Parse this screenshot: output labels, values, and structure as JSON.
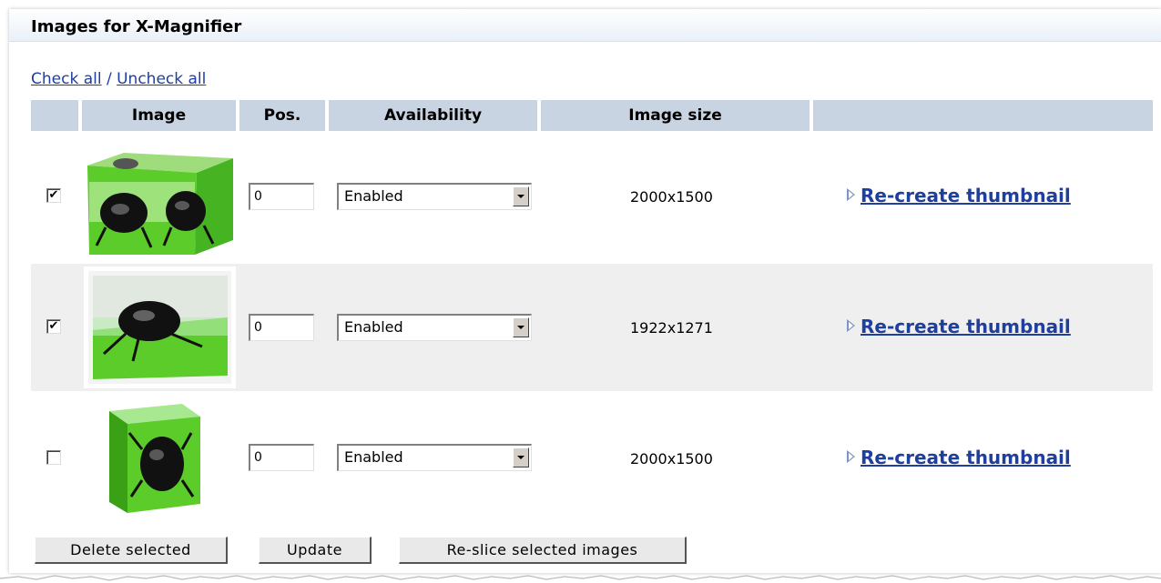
{
  "panel": {
    "title": "Images for X-Magnifier"
  },
  "links": {
    "check_all": "Check all",
    "separator": "/",
    "uncheck_all": "Uncheck all"
  },
  "columns": {
    "image": "Image",
    "pos": "Pos.",
    "availability": "Availability",
    "image_size": "Image size"
  },
  "rows": [
    {
      "checked": "✔",
      "pos": "0",
      "availability": "Enabled",
      "size": "2000x1500",
      "action": "Re-create thumbnail",
      "thumbnail": "beetle-in-resin-cube"
    },
    {
      "checked": "✔",
      "pos": "0",
      "availability": "Enabled",
      "size": "1922x1271",
      "action": "Re-create thumbnail",
      "thumbnail": "beetle-on-green-resin"
    },
    {
      "checked": "",
      "pos": "0",
      "availability": "Enabled",
      "size": "2000x1500",
      "action": "Re-create thumbnail",
      "thumbnail": "beetle-in-green-block"
    }
  ],
  "buttons": {
    "delete": "Delete selected",
    "update": "Update",
    "reslice": "Re-slice selected images"
  },
  "colors": {
    "header_bg": "#c8d4e2",
    "link": "#1f3f9f",
    "alt_row": "#efefef",
    "resin_green": "#5ccc2a"
  }
}
